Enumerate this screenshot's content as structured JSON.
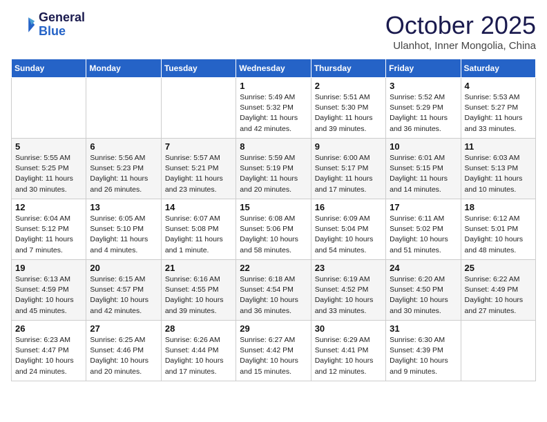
{
  "header": {
    "logo_line1": "General",
    "logo_line2": "Blue",
    "month": "October 2025",
    "location": "Ulanhot, Inner Mongolia, China"
  },
  "weekdays": [
    "Sunday",
    "Monday",
    "Tuesday",
    "Wednesday",
    "Thursday",
    "Friday",
    "Saturday"
  ],
  "weeks": [
    [
      {
        "day": "",
        "info": ""
      },
      {
        "day": "",
        "info": ""
      },
      {
        "day": "",
        "info": ""
      },
      {
        "day": "1",
        "info": "Sunrise: 5:49 AM\nSunset: 5:32 PM\nDaylight: 11 hours\nand 42 minutes."
      },
      {
        "day": "2",
        "info": "Sunrise: 5:51 AM\nSunset: 5:30 PM\nDaylight: 11 hours\nand 39 minutes."
      },
      {
        "day": "3",
        "info": "Sunrise: 5:52 AM\nSunset: 5:29 PM\nDaylight: 11 hours\nand 36 minutes."
      },
      {
        "day": "4",
        "info": "Sunrise: 5:53 AM\nSunset: 5:27 PM\nDaylight: 11 hours\nand 33 minutes."
      }
    ],
    [
      {
        "day": "5",
        "info": "Sunrise: 5:55 AM\nSunset: 5:25 PM\nDaylight: 11 hours\nand 30 minutes."
      },
      {
        "day": "6",
        "info": "Sunrise: 5:56 AM\nSunset: 5:23 PM\nDaylight: 11 hours\nand 26 minutes."
      },
      {
        "day": "7",
        "info": "Sunrise: 5:57 AM\nSunset: 5:21 PM\nDaylight: 11 hours\nand 23 minutes."
      },
      {
        "day": "8",
        "info": "Sunrise: 5:59 AM\nSunset: 5:19 PM\nDaylight: 11 hours\nand 20 minutes."
      },
      {
        "day": "9",
        "info": "Sunrise: 6:00 AM\nSunset: 5:17 PM\nDaylight: 11 hours\nand 17 minutes."
      },
      {
        "day": "10",
        "info": "Sunrise: 6:01 AM\nSunset: 5:15 PM\nDaylight: 11 hours\nand 14 minutes."
      },
      {
        "day": "11",
        "info": "Sunrise: 6:03 AM\nSunset: 5:13 PM\nDaylight: 11 hours\nand 10 minutes."
      }
    ],
    [
      {
        "day": "12",
        "info": "Sunrise: 6:04 AM\nSunset: 5:12 PM\nDaylight: 11 hours\nand 7 minutes."
      },
      {
        "day": "13",
        "info": "Sunrise: 6:05 AM\nSunset: 5:10 PM\nDaylight: 11 hours\nand 4 minutes."
      },
      {
        "day": "14",
        "info": "Sunrise: 6:07 AM\nSunset: 5:08 PM\nDaylight: 11 hours\nand 1 minute."
      },
      {
        "day": "15",
        "info": "Sunrise: 6:08 AM\nSunset: 5:06 PM\nDaylight: 10 hours\nand 58 minutes."
      },
      {
        "day": "16",
        "info": "Sunrise: 6:09 AM\nSunset: 5:04 PM\nDaylight: 10 hours\nand 54 minutes."
      },
      {
        "day": "17",
        "info": "Sunrise: 6:11 AM\nSunset: 5:02 PM\nDaylight: 10 hours\nand 51 minutes."
      },
      {
        "day": "18",
        "info": "Sunrise: 6:12 AM\nSunset: 5:01 PM\nDaylight: 10 hours\nand 48 minutes."
      }
    ],
    [
      {
        "day": "19",
        "info": "Sunrise: 6:13 AM\nSunset: 4:59 PM\nDaylight: 10 hours\nand 45 minutes."
      },
      {
        "day": "20",
        "info": "Sunrise: 6:15 AM\nSunset: 4:57 PM\nDaylight: 10 hours\nand 42 minutes."
      },
      {
        "day": "21",
        "info": "Sunrise: 6:16 AM\nSunset: 4:55 PM\nDaylight: 10 hours\nand 39 minutes."
      },
      {
        "day": "22",
        "info": "Sunrise: 6:18 AM\nSunset: 4:54 PM\nDaylight: 10 hours\nand 36 minutes."
      },
      {
        "day": "23",
        "info": "Sunrise: 6:19 AM\nSunset: 4:52 PM\nDaylight: 10 hours\nand 33 minutes."
      },
      {
        "day": "24",
        "info": "Sunrise: 6:20 AM\nSunset: 4:50 PM\nDaylight: 10 hours\nand 30 minutes."
      },
      {
        "day": "25",
        "info": "Sunrise: 6:22 AM\nSunset: 4:49 PM\nDaylight: 10 hours\nand 27 minutes."
      }
    ],
    [
      {
        "day": "26",
        "info": "Sunrise: 6:23 AM\nSunset: 4:47 PM\nDaylight: 10 hours\nand 24 minutes."
      },
      {
        "day": "27",
        "info": "Sunrise: 6:25 AM\nSunset: 4:46 PM\nDaylight: 10 hours\nand 20 minutes."
      },
      {
        "day": "28",
        "info": "Sunrise: 6:26 AM\nSunset: 4:44 PM\nDaylight: 10 hours\nand 17 minutes."
      },
      {
        "day": "29",
        "info": "Sunrise: 6:27 AM\nSunset: 4:42 PM\nDaylight: 10 hours\nand 15 minutes."
      },
      {
        "day": "30",
        "info": "Sunrise: 6:29 AM\nSunset: 4:41 PM\nDaylight: 10 hours\nand 12 minutes."
      },
      {
        "day": "31",
        "info": "Sunrise: 6:30 AM\nSunset: 4:39 PM\nDaylight: 10 hours\nand 9 minutes."
      },
      {
        "day": "",
        "info": ""
      }
    ]
  ]
}
